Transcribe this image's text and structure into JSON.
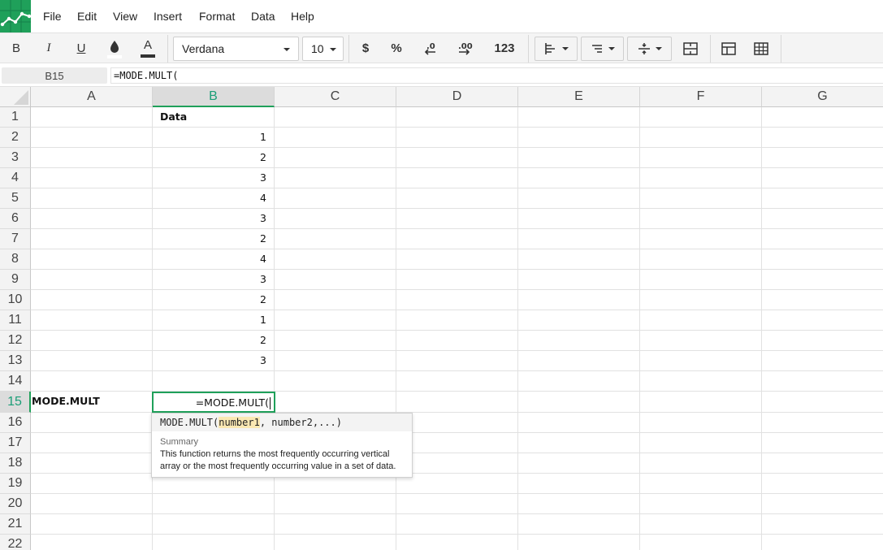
{
  "menu": [
    "File",
    "Edit",
    "View",
    "Insert",
    "Format",
    "Data",
    "Help"
  ],
  "toolbar": {
    "bold": "B",
    "italic": "I",
    "underline": "U",
    "text_color": "A",
    "font_family": "Verdana",
    "font_size": "10",
    "currency": "$",
    "percent": "%",
    "number_format": "123"
  },
  "formula_bar": {
    "cell_ref": "B15",
    "formula": "=MODE.MULT("
  },
  "columns": [
    "A",
    "B",
    "C",
    "D",
    "E",
    "F",
    "G"
  ],
  "active_column": "B",
  "rows": [
    "1",
    "2",
    "3",
    "4",
    "5",
    "6",
    "7",
    "8",
    "9",
    "10",
    "11",
    "12",
    "13",
    "14",
    "15",
    "16",
    "17",
    "18",
    "19",
    "20",
    "21",
    "22"
  ],
  "active_row": "15",
  "cells": {
    "B1": "Data",
    "B2": "1",
    "B3": "2",
    "B4": "3",
    "B5": "4",
    "B6": "3",
    "B7": "2",
    "B8": "4",
    "B9": "3",
    "B10": "2",
    "B11": "1",
    "B12": "2",
    "B13": "3",
    "A15": "MODE.MULT",
    "B15": "=MODE.MULT("
  },
  "tooltip": {
    "fn_name": "MODE.MULT(",
    "active_arg": "number1",
    "rest_args": ", number2,...)",
    "summary_label": "Summary",
    "summary": "This function returns the most frequently occurring vertical array or the most frequently occurring value in a set of data."
  },
  "colors": {
    "accent": "#1fa05a",
    "active_header_text": "#1b9e77",
    "arg_highlight": "#fbe8b3"
  }
}
